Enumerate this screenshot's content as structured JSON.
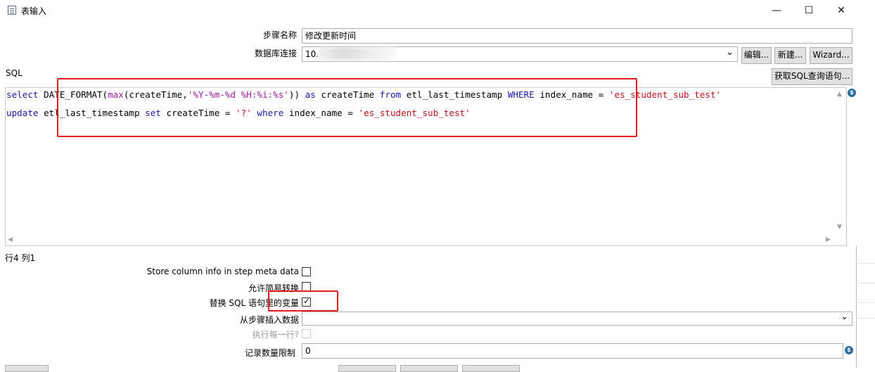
{
  "window": {
    "title": "表输入",
    "minimize": "—",
    "maximize": "☐",
    "close": "✕"
  },
  "form": {
    "step_name_label": "步骤名称",
    "step_name_value": "修改更新时间",
    "db_conn_label": "数据库连接",
    "db_conn_value": "10.",
    "edit_btn": "编辑...",
    "new_btn": "新建...",
    "wizard_btn": "Wizard...",
    "sql_label": "SQL",
    "get_sql_btn": "获取SQL查询语句..."
  },
  "sql": {
    "line1": {
      "t1": "select",
      "t2": " DATE_FORMAT(",
      "t3": "max",
      "t4": "(createTime,",
      "t5": "'%Y-%m-%d %H:%i:%s'",
      "t6": ")) ",
      "t7": "as",
      "t8": " createTime ",
      "t9": "from",
      "t10": " etl_last_timestamp ",
      "t11": "WHERE",
      "t12": " index_name = ",
      "t13": "'es_student_sub_test'"
    },
    "line2": {
      "t1": "update",
      "t2": " etl_last_timestamp ",
      "t3": "set",
      "t4": " createTime = ",
      "t5": "'?'",
      "t6": " ",
      "t7": "where",
      "t8": " index_name = ",
      "t9": "'es_student_sub_test'"
    }
  },
  "status": {
    "cursor_pos": "行4 列1"
  },
  "options": {
    "store_meta_label": "Store column info in step meta data",
    "lazy_conv_label": "允许简易转换",
    "replace_vars_label": "替换 SQL 语句里的变量",
    "insert_from_label": "从步骤插入数据",
    "exec_each_label": "执行每一行?",
    "limit_label": "记录数量限制",
    "limit_value": "0",
    "store_meta_checked": false,
    "lazy_conv_checked": false,
    "replace_vars_checked": true,
    "exec_each_checked": false
  },
  "icons": {
    "dollar": "$",
    "dropdown": "⌄",
    "scroll_up": "▲",
    "scroll_down": "▼",
    "scroll_left": "◀",
    "scroll_right": "▶",
    "checkmark": "✓"
  },
  "colors": {
    "keyword": "#1a1aa6",
    "function": "#a0209f",
    "string": "#c0101b",
    "highlight_box": "#e81c1c"
  }
}
